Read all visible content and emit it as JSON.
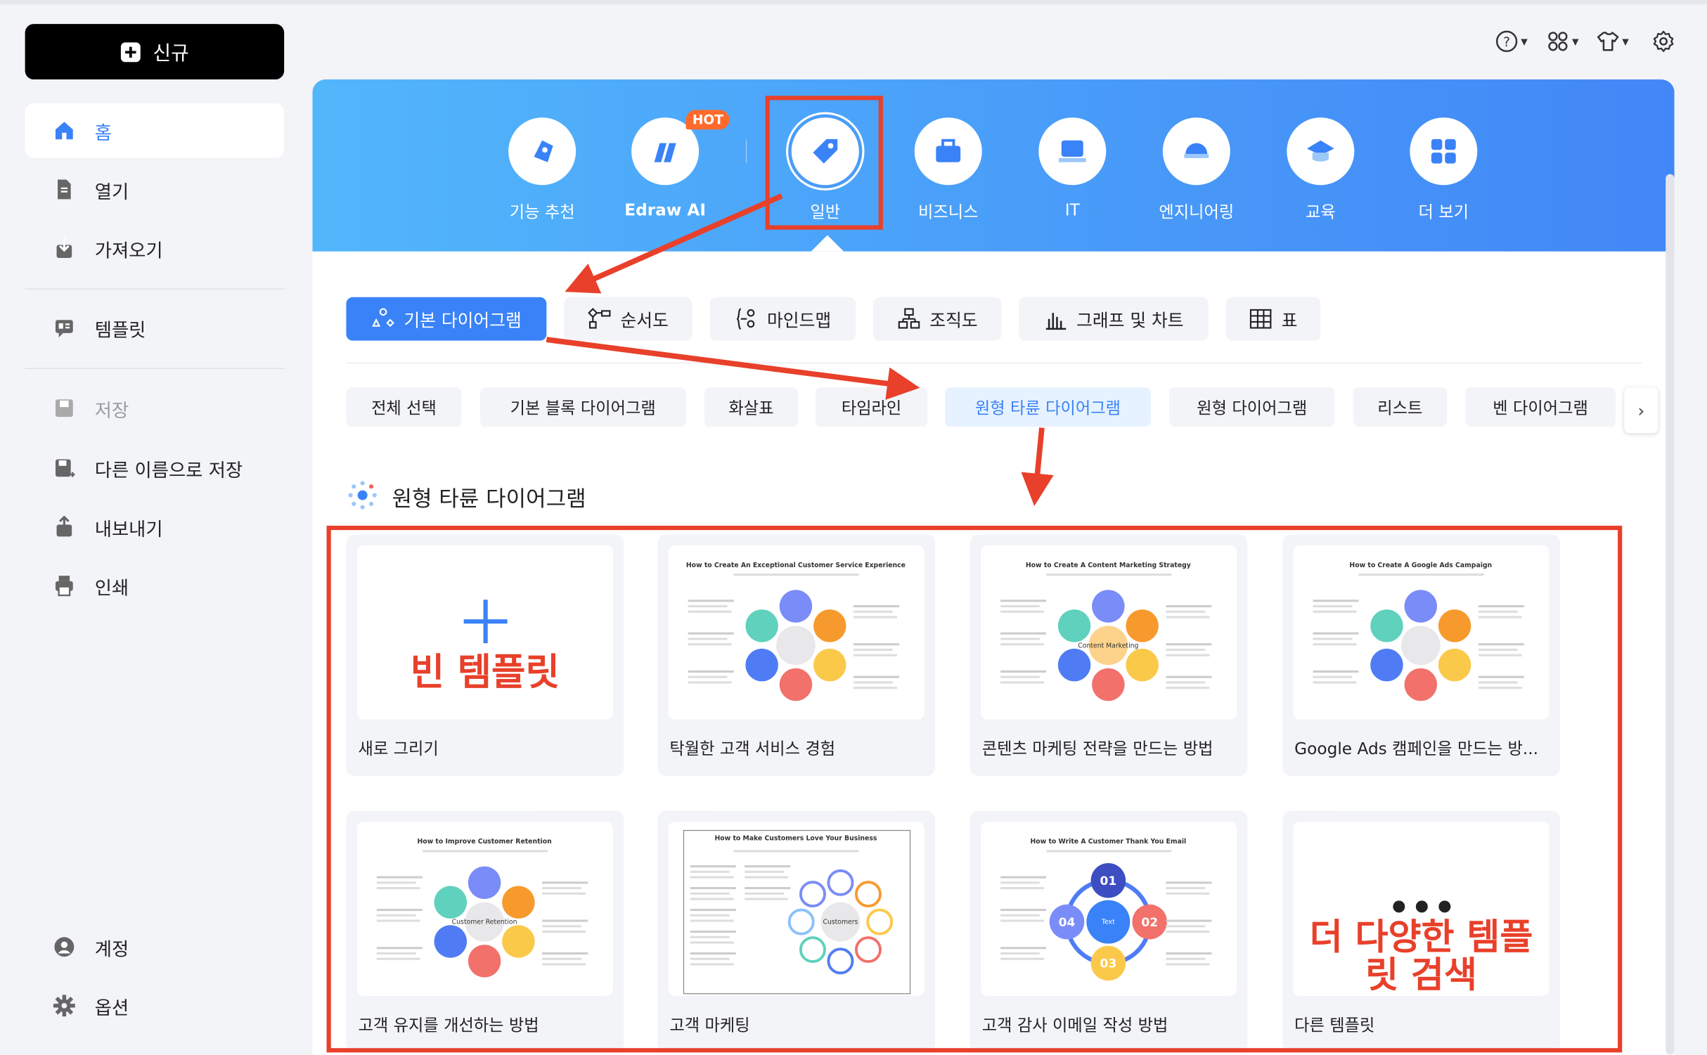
{
  "colors": {
    "accent": "#3a82f7",
    "annotation": "#e8402a",
    "background": "#f3f4f8",
    "banner_start": "#52b6fb",
    "banner_end": "#4287f7",
    "hot": "#ff6a2b"
  },
  "sidebar": {
    "new_label": "신규",
    "items": [
      {
        "label": "홈",
        "icon": "home-icon",
        "active": true
      },
      {
        "label": "열기",
        "icon": "file-icon"
      },
      {
        "label": "가져오기",
        "icon": "import-icon"
      },
      {
        "label": "템플릿",
        "icon": "template-icon"
      },
      {
        "label": "저장",
        "icon": "save-icon",
        "disabled": true
      },
      {
        "label": "다른 이름으로 저장",
        "icon": "save-as-icon"
      },
      {
        "label": "내보내기",
        "icon": "export-icon"
      },
      {
        "label": "인쇄",
        "icon": "print-icon"
      },
      {
        "label": "계정",
        "icon": "account-icon"
      },
      {
        "label": "옵션",
        "icon": "gear-icon"
      }
    ]
  },
  "toolbar": {
    "icons": [
      "help-icon",
      "apps-icon",
      "theme-shirt-icon",
      "settings-icon"
    ]
  },
  "categories": [
    {
      "label": "기능 추천"
    },
    {
      "label": "Edraw AI",
      "badge": "HOT"
    },
    {
      "label": "일반",
      "selected": true
    },
    {
      "label": "비즈니스"
    },
    {
      "label": "IT"
    },
    {
      "label": "엔지니어링"
    },
    {
      "label": "교육"
    },
    {
      "label": "더 보기"
    }
  ],
  "tabs": [
    {
      "label": "기본 다이어그램",
      "selected": true
    },
    {
      "label": "순서도"
    },
    {
      "label": "마인드맵"
    },
    {
      "label": "조직도"
    },
    {
      "label": "그래프 및 차트"
    },
    {
      "label": "표"
    }
  ],
  "subtabs": [
    {
      "label": "전체 선택"
    },
    {
      "label": "기본 블록 다이어그램"
    },
    {
      "label": "화살표"
    },
    {
      "label": "타임라인"
    },
    {
      "label": "원형 타륜 다이어그램",
      "selected": true
    },
    {
      "label": "원형 다이어그램"
    },
    {
      "label": "리스트"
    },
    {
      "label": "벤 다이어그램"
    }
  ],
  "next_label": "›",
  "section_title": "원형 타륜 다이어그램",
  "cards": [
    {
      "label": "새로 그리기",
      "overlay": "빈 템플릿",
      "thumb_title": ""
    },
    {
      "label": "탁월한 고객 서비스 경험",
      "thumb_title": "How to Create An Exceptional Customer Service Experience"
    },
    {
      "label": "콘텐츠 마케팅 전략을 만드는 방법",
      "thumb_title": "How to Create A Content Marketing Strategy",
      "center": "Content Marketing"
    },
    {
      "label": "Google Ads 캠페인을 만드는 방...",
      "thumb_title": "How to Create A Google Ads Campaign"
    },
    {
      "label": "고객 유지를 개선하는 방법",
      "thumb_title": "How to Improve Customer Retention",
      "center": "Customer Retention"
    },
    {
      "label": "고객 마케팅",
      "thumb_title": "How to Make Customers Love Your Business",
      "center": "Customers"
    },
    {
      "label": "고객 감사 이메일 작성 방법",
      "thumb_title": "How to Write A Customer Thank You Email",
      "center": "Text"
    },
    {
      "label": "다른 템플릿",
      "overlay": "더 다양한 템플릿 검색",
      "thumb_title": ""
    }
  ]
}
